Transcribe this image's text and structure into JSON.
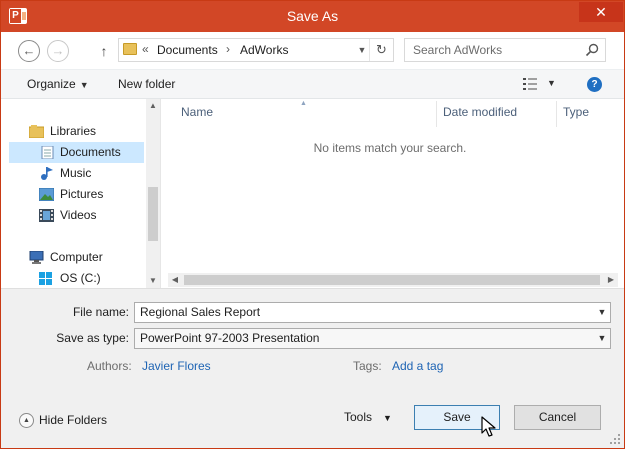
{
  "window": {
    "title": "Save As",
    "app_icon": "powerpoint-icon",
    "close_glyph": "✕",
    "accent_color": "#d24726"
  },
  "navigation": {
    "back_icon": "back-arrow-icon",
    "forward_icon": "forward-arrow-icon",
    "up_icon": "up-arrow-icon",
    "breadcrumb": {
      "overflow": "«",
      "items": [
        "Documents",
        "AdWorks"
      ],
      "separator": "›"
    },
    "refresh_icon": "refresh-icon",
    "search": {
      "placeholder": "Search AdWorks"
    }
  },
  "toolbar": {
    "organize_label": "Organize",
    "new_folder_label": "New folder",
    "view_icon": "details-view-icon",
    "help_icon": "help-icon"
  },
  "nav_pane": {
    "items": [
      {
        "label": "Libraries",
        "icon": "libraries-icon"
      },
      {
        "label": "Documents",
        "icon": "documents-icon",
        "selected": true
      },
      {
        "label": "Music",
        "icon": "music-icon"
      },
      {
        "label": "Pictures",
        "icon": "pictures-icon"
      },
      {
        "label": "Videos",
        "icon": "videos-icon"
      },
      {
        "label": "Computer",
        "icon": "computer-icon"
      },
      {
        "label": "OS (C:)",
        "icon": "drive-icon"
      }
    ]
  },
  "file_list": {
    "columns": [
      "Name",
      "Date modified",
      "Type"
    ],
    "sorted_by": "Name",
    "empty_message": "No items match your search."
  },
  "form": {
    "file_name_label": "File name:",
    "file_name_value": "Regional Sales Report",
    "save_as_type_label": "Save as type:",
    "save_as_type_value": "PowerPoint 97-2003 Presentation",
    "authors_label": "Authors:",
    "authors_value": "Javier Flores",
    "tags_label": "Tags:",
    "tags_value": "Add a tag"
  },
  "footer": {
    "hide_folders_label": "Hide Folders",
    "tools_label": "Tools",
    "save_label": "Save",
    "cancel_label": "Cancel"
  }
}
